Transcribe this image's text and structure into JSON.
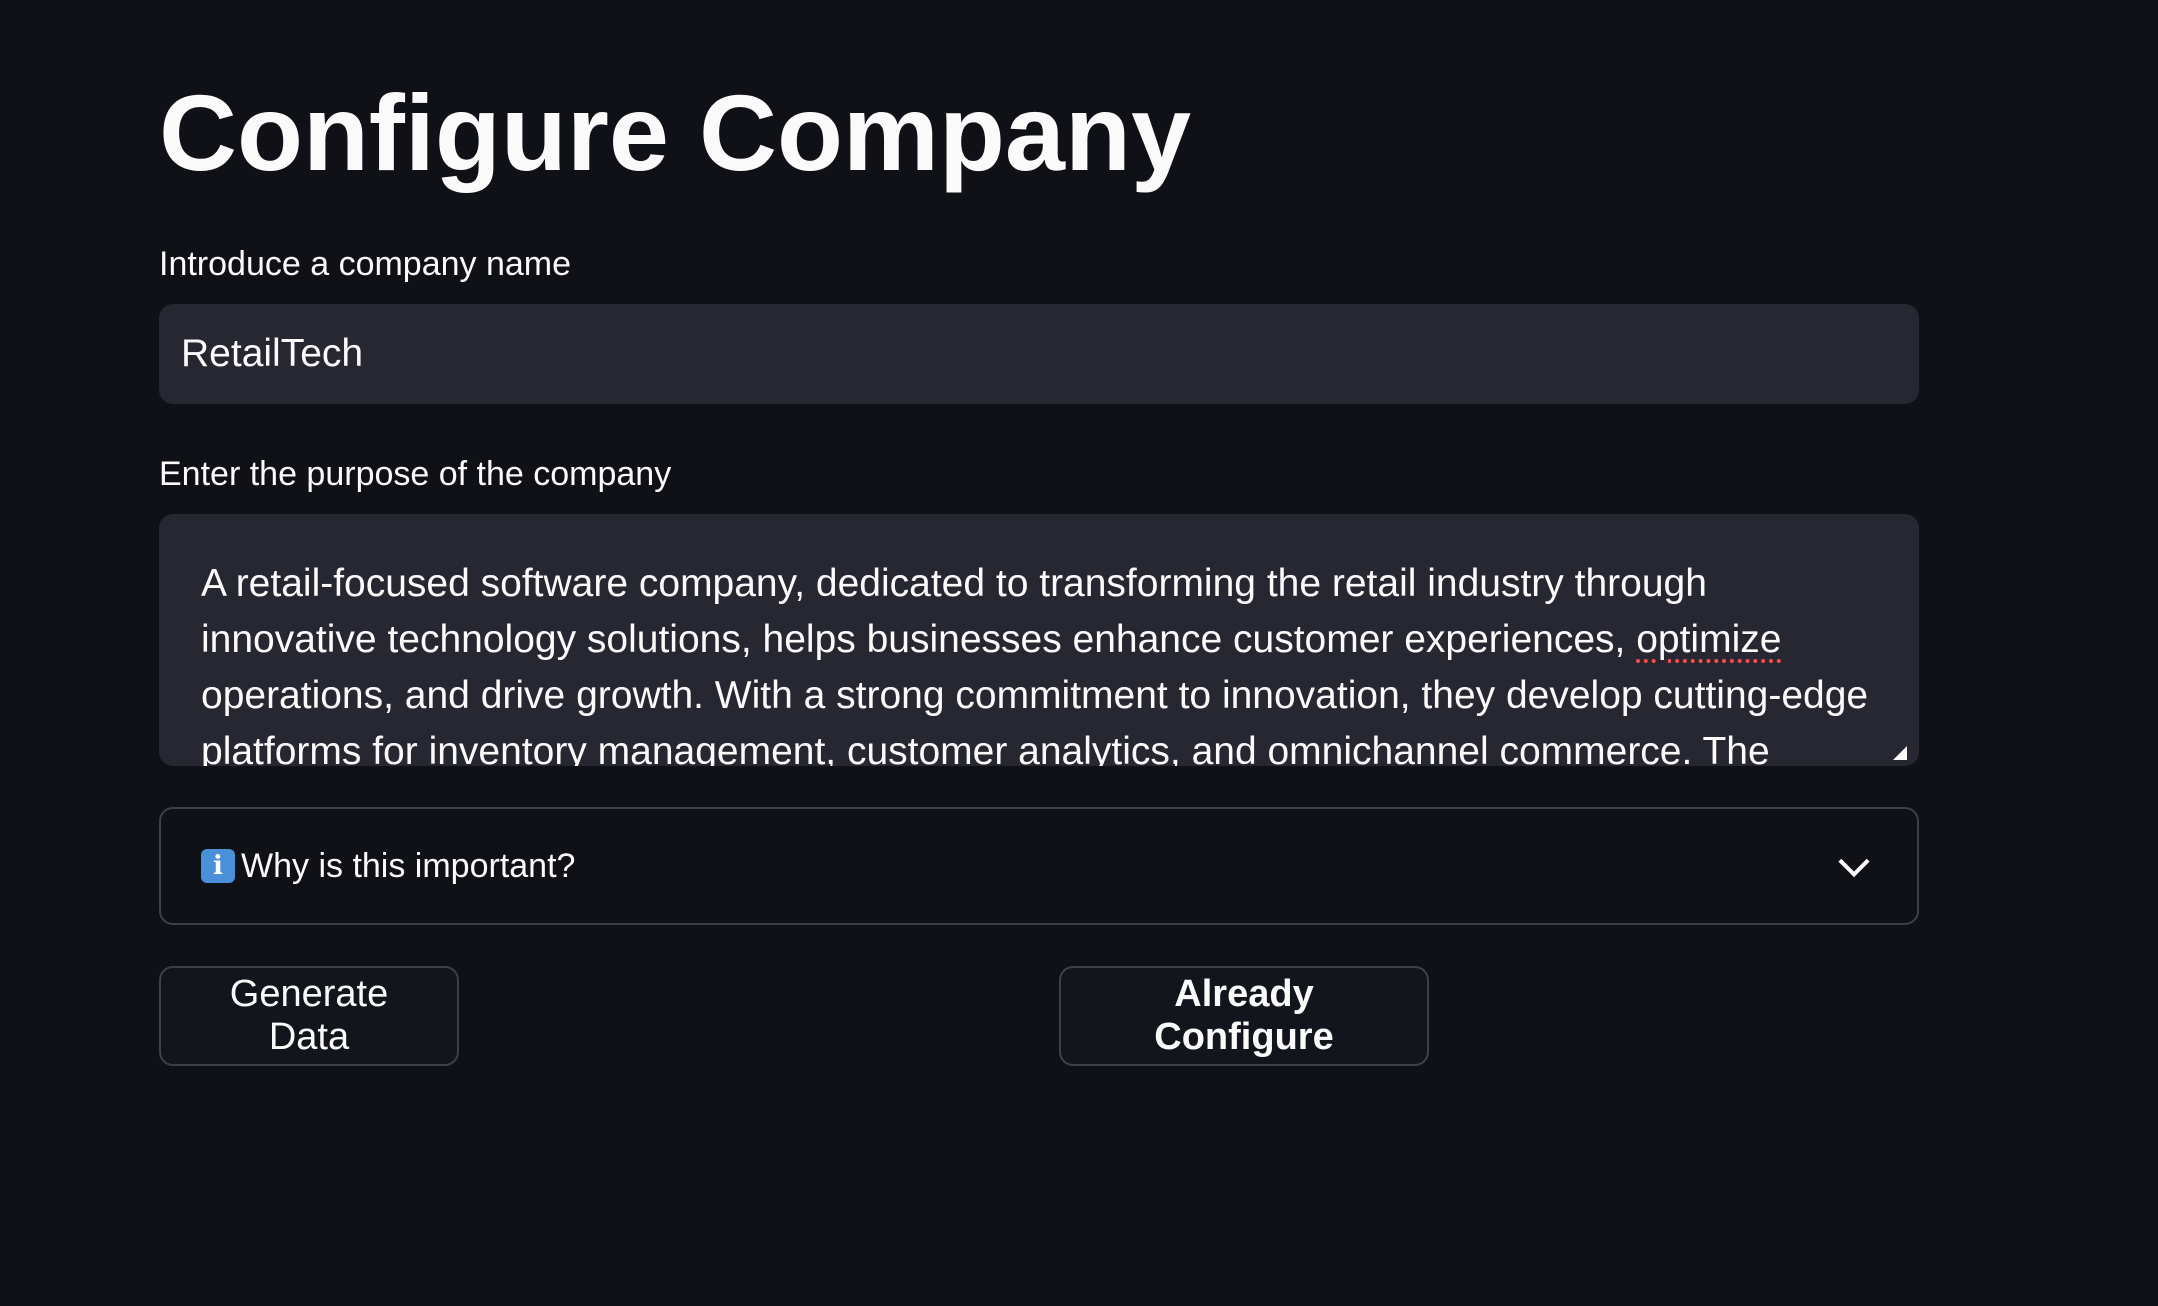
{
  "header": {
    "title": "Configure Company"
  },
  "company_name": {
    "label": "Introduce a company name",
    "value": "RetailTech"
  },
  "purpose": {
    "label": "Enter the purpose of the company",
    "text_part1": "A retail-focused software company, dedicated to transforming the retail industry through innovative technology solutions, helps businesses enhance customer experiences, ",
    "misspelled_word": "optimize",
    "text_part2": " operations, and drive growth. With a strong commitment to innovation, they develop cutting-edge platforms for inventory management, customer analytics, and omnichannel commerce. The company fosters a"
  },
  "expander": {
    "icon": "info-icon",
    "icon_glyph": "i",
    "label": "Why is this important?"
  },
  "buttons": {
    "generate_label": "Generate Data",
    "configure_label": "Already Configure"
  },
  "colors": {
    "background": "#0f1116",
    "input_background": "#262730",
    "border": "#3d3f4a",
    "text": "#fafafa"
  }
}
